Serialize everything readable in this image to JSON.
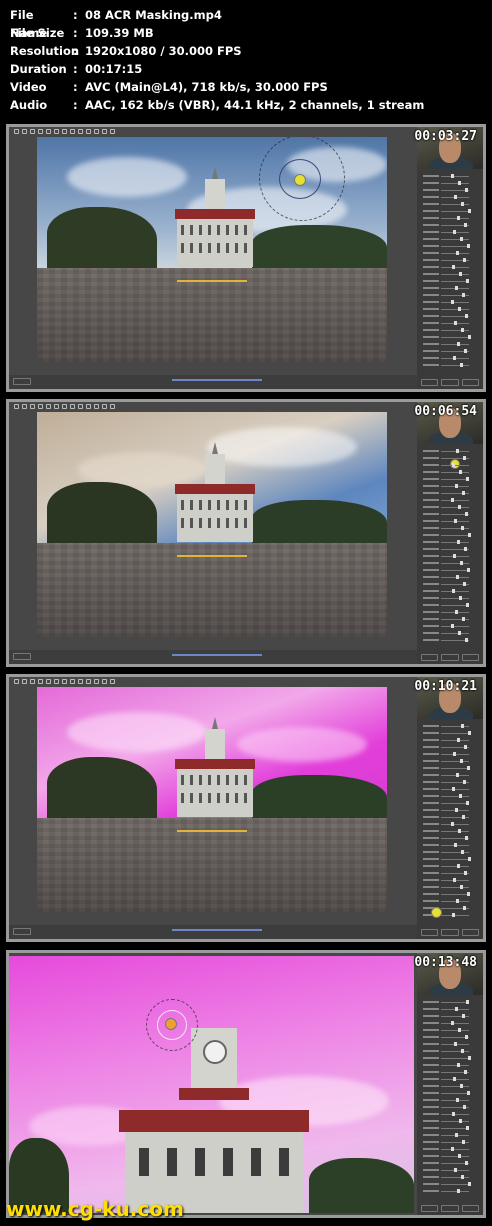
{
  "file_info": [
    {
      "label": "File Name",
      "value": "08 ACR Masking.mp4"
    },
    {
      "label": "File Size",
      "value": "109.39 MB"
    },
    {
      "label": "Resolution",
      "value": "1920x1080 / 30.000 FPS"
    },
    {
      "label": "Duration",
      "value": "00:17:15"
    },
    {
      "label": "Video",
      "value": "AVC (Main@L4), 718 kb/s, 30.000 FPS"
    },
    {
      "label": "Audio",
      "value": "AAC, 162 kb/s (VBR), 44.1 kHz, 2 channels, 1 stream"
    }
  ],
  "separator": ":",
  "thumbnails": [
    {
      "timestamp": "00:03:27",
      "variant": "blue-sky-yellow-pin"
    },
    {
      "timestamp": "00:06:54",
      "variant": "warm-sky"
    },
    {
      "timestamp": "00:10:21",
      "variant": "magenta-mask-sky"
    },
    {
      "timestamp": "00:13:48",
      "variant": "magenta-mask-zoomed-orange-pin"
    }
  ],
  "watermark": "www.cg-ku.com",
  "colors": {
    "mask_overlay": "#ea3fe0",
    "pin_yellow": "#e8e030",
    "pin_orange": "#f0a030",
    "watermark": "#ffde00"
  }
}
